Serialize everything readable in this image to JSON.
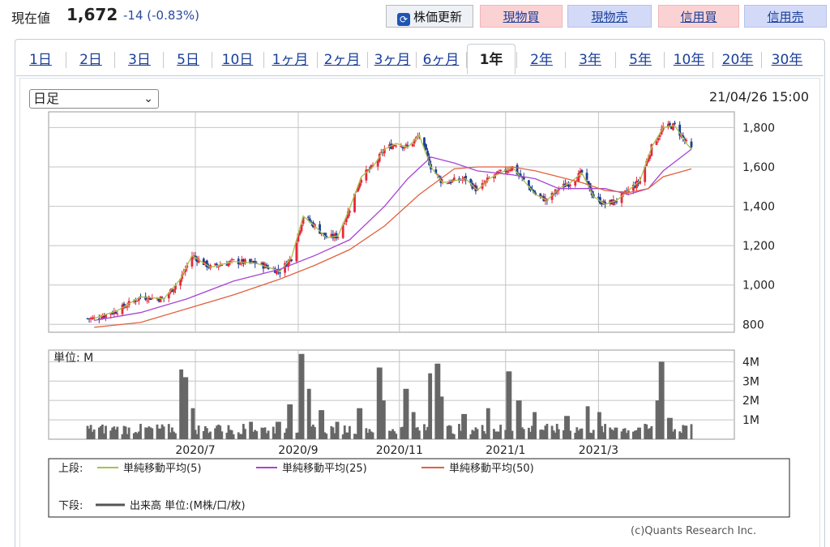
{
  "header": {
    "price_label": "現在値",
    "price_value": "1,672",
    "price_change": "-14 (-0.83%)",
    "buttons": {
      "refresh": "株価更新",
      "genbutsu_buy": "現物買",
      "genbutsu_sell": "現物売",
      "shinyo_buy": "信用買",
      "shinyo_sell": "信用売"
    }
  },
  "tabs": [
    "1日",
    "2日",
    "3日",
    "5日",
    "10日",
    "1ヶ月",
    "2ヶ月",
    "3ヶ月",
    "6ヶ月",
    "1年",
    "2年",
    "3年",
    "5年",
    "10年",
    "20年",
    "30年"
  ],
  "active_tab": "1年",
  "period_select": {
    "value": "日足"
  },
  "datetime": "21/04/26 15:00",
  "copyright": "(c)Quants Research Inc.",
  "colors": {
    "up": "#e8283c",
    "down": "#1d3f8f",
    "ma5": "#a6c24a",
    "ma25": "#a745d6",
    "ma50": "#e0613e",
    "volume": "#676767",
    "grid": "#c4c4c4"
  },
  "legend": {
    "upper_label": "上段:",
    "lower_label": "下段:",
    "ma5": "単純移動平均(5)",
    "ma25": "単純移動平均(25)",
    "ma50": "単純移動平均(50)",
    "volume": "出来高 単位:(M株/口/枚)"
  },
  "chart_data": [
    {
      "type": "candlestick",
      "ylim": [
        760,
        1880
      ],
      "yticks": [
        800,
        1000,
        1200,
        1400,
        1600,
        1800
      ],
      "ytick_labels": [
        "800",
        "1,000",
        "1,200",
        "1,400",
        "1,600",
        "1,800"
      ],
      "x_range": [
        "2020-04-27",
        "2021-04-26"
      ],
      "series": [
        {
          "name": "単純移動平均(5)",
          "points": [
            [
              "2020-05-01",
              830
            ],
            [
              "2020-05-15",
              870
            ],
            [
              "2020-05-29",
              940
            ],
            [
              "2020-06-12",
              930
            ],
            [
              "2020-06-22",
              1030
            ],
            [
              "2020-06-29",
              1150
            ],
            [
              "2020-07-10",
              1090
            ],
            [
              "2020-07-24",
              1120
            ],
            [
              "2020-08-07",
              1110
            ],
            [
              "2020-08-21",
              1070
            ],
            [
              "2020-08-28",
              1140
            ],
            [
              "2020-09-04",
              1350
            ],
            [
              "2020-09-11",
              1300
            ],
            [
              "2020-09-18",
              1240
            ],
            [
              "2020-09-25",
              1250
            ],
            [
              "2020-10-02",
              1390
            ],
            [
              "2020-10-09",
              1550
            ],
            [
              "2020-10-16",
              1600
            ],
            [
              "2020-10-23",
              1690
            ],
            [
              "2020-10-30",
              1720
            ],
            [
              "2020-11-06",
              1700
            ],
            [
              "2020-11-13",
              1760
            ],
            [
              "2020-11-20",
              1600
            ],
            [
              "2020-11-27",
              1520
            ],
            [
              "2020-12-04",
              1530
            ],
            [
              "2020-12-11",
              1540
            ],
            [
              "2020-12-18",
              1480
            ],
            [
              "2020-12-25",
              1540
            ],
            [
              "2021-01-08",
              1600
            ],
            [
              "2021-01-15",
              1530
            ],
            [
              "2021-01-22",
              1460
            ],
            [
              "2021-01-29",
              1430
            ],
            [
              "2021-02-05",
              1490
            ],
            [
              "2021-02-12",
              1520
            ],
            [
              "2021-02-19",
              1570
            ],
            [
              "2021-02-26",
              1450
            ],
            [
              "2021-03-05",
              1410
            ],
            [
              "2021-03-12",
              1430
            ],
            [
              "2021-03-19",
              1480
            ],
            [
              "2021-03-26",
              1530
            ],
            [
              "2021-04-02",
              1700
            ],
            [
              "2021-04-09",
              1800
            ],
            [
              "2021-04-16",
              1810
            ],
            [
              "2021-04-23",
              1720
            ],
            [
              "2021-04-26",
              1690
            ]
          ]
        },
        {
          "name": "単純移動平均(25)",
          "points": [
            [
              "2020-05-01",
              820
            ],
            [
              "2020-05-29",
              860
            ],
            [
              "2020-06-26",
              930
            ],
            [
              "2020-07-24",
              1020
            ],
            [
              "2020-08-21",
              1080
            ],
            [
              "2020-09-11",
              1150
            ],
            [
              "2020-10-02",
              1230
            ],
            [
              "2020-10-23",
              1400
            ],
            [
              "2020-11-06",
              1540
            ],
            [
              "2020-11-20",
              1650
            ],
            [
              "2020-12-04",
              1620
            ],
            [
              "2020-12-18",
              1580
            ],
            [
              "2021-01-08",
              1560
            ],
            [
              "2021-01-22",
              1540
            ],
            [
              "2021-02-05",
              1490
            ],
            [
              "2021-02-19",
              1490
            ],
            [
              "2021-03-05",
              1490
            ],
            [
              "2021-03-19",
              1460
            ],
            [
              "2021-03-31",
              1490
            ],
            [
              "2021-04-09",
              1580
            ],
            [
              "2021-04-26",
              1690
            ]
          ]
        },
        {
          "name": "単純移動平均(50)",
          "points": [
            [
              "2020-05-01",
              785
            ],
            [
              "2020-05-29",
              810
            ],
            [
              "2020-06-26",
              880
            ],
            [
              "2020-07-24",
              950
            ],
            [
              "2020-08-21",
              1030
            ],
            [
              "2020-09-11",
              1100
            ],
            [
              "2020-10-02",
              1180
            ],
            [
              "2020-10-23",
              1300
            ],
            [
              "2020-11-13",
              1460
            ],
            [
              "2020-12-04",
              1590
            ],
            [
              "2020-12-18",
              1600
            ],
            [
              "2021-01-08",
              1600
            ],
            [
              "2021-01-22",
              1580
            ],
            [
              "2021-02-05",
              1550
            ],
            [
              "2021-02-19",
              1520
            ],
            [
              "2021-03-05",
              1480
            ],
            [
              "2021-03-19",
              1470
            ],
            [
              "2021-03-31",
              1490
            ],
            [
              "2021-04-09",
              1550
            ],
            [
              "2021-04-26",
              1590
            ]
          ]
        }
      ]
    },
    {
      "type": "bar",
      "ylim": [
        0,
        4.6
      ],
      "yticks": [
        1,
        2,
        3,
        4
      ],
      "ytick_labels": [
        "1M",
        "2M",
        "3M",
        "4M"
      ],
      "unit_label": "単位: M",
      "x_tick_labels": [
        [
          "2020-07-01",
          "2020/7"
        ],
        [
          "2020-09-01",
          "2020/9"
        ],
        [
          "2020-11-01",
          "2020/11"
        ],
        [
          "2021-01-04",
          "2021/1"
        ],
        [
          "2021-03-01",
          "2021/3"
        ]
      ],
      "series": [
        {
          "name": "出来高",
          "points": [
            [
              "2020-05-15",
              0.5
            ],
            [
              "2020-06-01",
              0.4
            ],
            [
              "2020-06-22",
              3.6
            ],
            [
              "2020-06-25",
              3.2
            ],
            [
              "2020-06-29",
              1.6
            ],
            [
              "2020-07-15",
              0.7
            ],
            [
              "2020-08-03",
              0.9
            ],
            [
              "2020-08-20",
              0.9
            ],
            [
              "2020-08-27",
              1.8
            ],
            [
              "2020-09-03",
              4.4
            ],
            [
              "2020-09-07",
              2.6
            ],
            [
              "2020-09-15",
              1.5
            ],
            [
              "2020-09-25",
              0.9
            ],
            [
              "2020-10-08",
              1.6
            ],
            [
              "2020-10-20",
              3.7
            ],
            [
              "2020-10-23",
              2.0
            ],
            [
              "2020-11-05",
              2.6
            ],
            [
              "2020-11-09",
              1.4
            ],
            [
              "2020-11-20",
              3.4
            ],
            [
              "2020-11-24",
              3.9
            ],
            [
              "2020-11-27",
              2.2
            ],
            [
              "2020-12-10",
              1.3
            ],
            [
              "2020-12-25",
              1.6
            ],
            [
              "2021-01-06",
              3.5
            ],
            [
              "2021-01-12",
              2.0
            ],
            [
              "2021-01-22",
              1.4
            ],
            [
              "2021-02-10",
              1.2
            ],
            [
              "2021-02-22",
              1.7
            ],
            [
              "2021-03-01",
              1.4
            ],
            [
              "2021-03-12",
              0.6
            ],
            [
              "2021-03-26",
              0.6
            ],
            [
              "2021-04-05",
              2.0
            ],
            [
              "2021-04-08",
              4.0
            ],
            [
              "2021-04-13",
              1.1
            ],
            [
              "2021-04-22",
              0.7
            ],
            [
              "2021-04-26",
              0.5
            ]
          ]
        }
      ]
    }
  ]
}
